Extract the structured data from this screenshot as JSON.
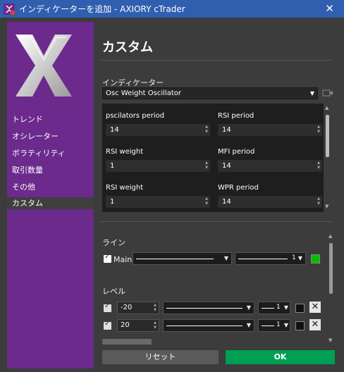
{
  "window": {
    "title": "インディケーターを追加 - AXIORY cTrader",
    "app_icon": "ctrader-icon",
    "close_icon": "close-icon"
  },
  "colors": {
    "titlebar": "#2f5fae",
    "sidebar": "#6b2a8c",
    "ok_button": "#009f53",
    "line_color": "#00c000"
  },
  "sidebar": {
    "items": [
      {
        "label": "トレンド"
      },
      {
        "label": "オシレーター"
      },
      {
        "label": "ボラティリティ"
      },
      {
        "label": "取引数量"
      },
      {
        "label": "その他"
      },
      {
        "label": "カスタム",
        "selected": true
      }
    ]
  },
  "main": {
    "title": "カスタム",
    "indicator_label": "インディケーター",
    "indicator_value": "Osc Weight Oscillator",
    "params": [
      {
        "label": "pscilators period",
        "value": "14"
      },
      {
        "label": "RSI period",
        "value": "14"
      },
      {
        "label": "RSI weight",
        "value": "1"
      },
      {
        "label": "MFI period",
        "value": "14"
      },
      {
        "label": "RSI weight",
        "value": "1"
      },
      {
        "label": "WPR period",
        "value": "14"
      }
    ],
    "lines_label": "ライン",
    "line_main": {
      "label": "Main",
      "checked": true,
      "width": "1"
    },
    "levels_label": "レベル",
    "levels": [
      {
        "value": "-20",
        "width": "1",
        "checked": true
      },
      {
        "value": "20",
        "width": "1",
        "checked": true
      }
    ]
  },
  "buttons": {
    "reset": "リセット",
    "ok": "OK"
  }
}
